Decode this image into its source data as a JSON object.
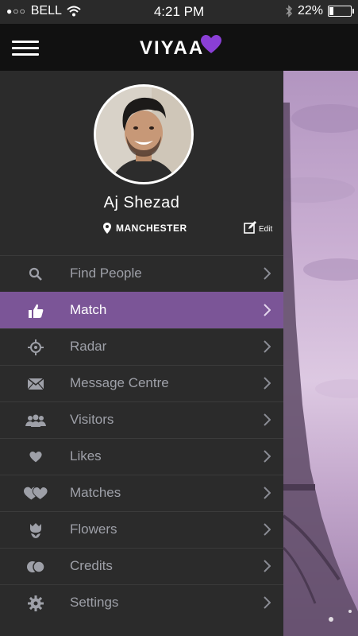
{
  "status_bar": {
    "signal": "●○○",
    "carrier": "BELL",
    "time": "4:21 PM",
    "battery": "22%",
    "battery_level": 0.22
  },
  "header": {
    "logo_text": "VIYAA",
    "menu_icon": "hamburger-icon",
    "logo_icon": "heart-icon"
  },
  "profile": {
    "name": "Aj Shezad",
    "location": "MANCHESTER",
    "edit_label": "Edit",
    "location_icon": "map-pin-icon",
    "edit_icon": "edit-icon"
  },
  "menu": [
    {
      "label": "Find People",
      "icon": "search-icon",
      "active": false
    },
    {
      "label": "Match",
      "icon": "thumbs-up-icon",
      "active": true
    },
    {
      "label": "Radar",
      "icon": "crosshair-icon",
      "active": false
    },
    {
      "label": "Message Centre",
      "icon": "envelope-icon",
      "active": false
    },
    {
      "label": "Visitors",
      "icon": "users-icon",
      "active": false
    },
    {
      "label": "Likes",
      "icon": "heart-icon",
      "active": false
    },
    {
      "label": "Matches",
      "icon": "double-heart-icon",
      "active": false
    },
    {
      "label": "Flowers",
      "icon": "flower-icon",
      "active": false
    },
    {
      "label": "Credits",
      "icon": "coins-icon",
      "active": false
    },
    {
      "label": "Settings",
      "icon": "gear-icon",
      "active": false
    }
  ],
  "colors": {
    "accent": "#7b5597",
    "logo_heart": "#8a3fd6",
    "drawer_bg": "#2b2b2b",
    "header_bg": "#111111"
  }
}
